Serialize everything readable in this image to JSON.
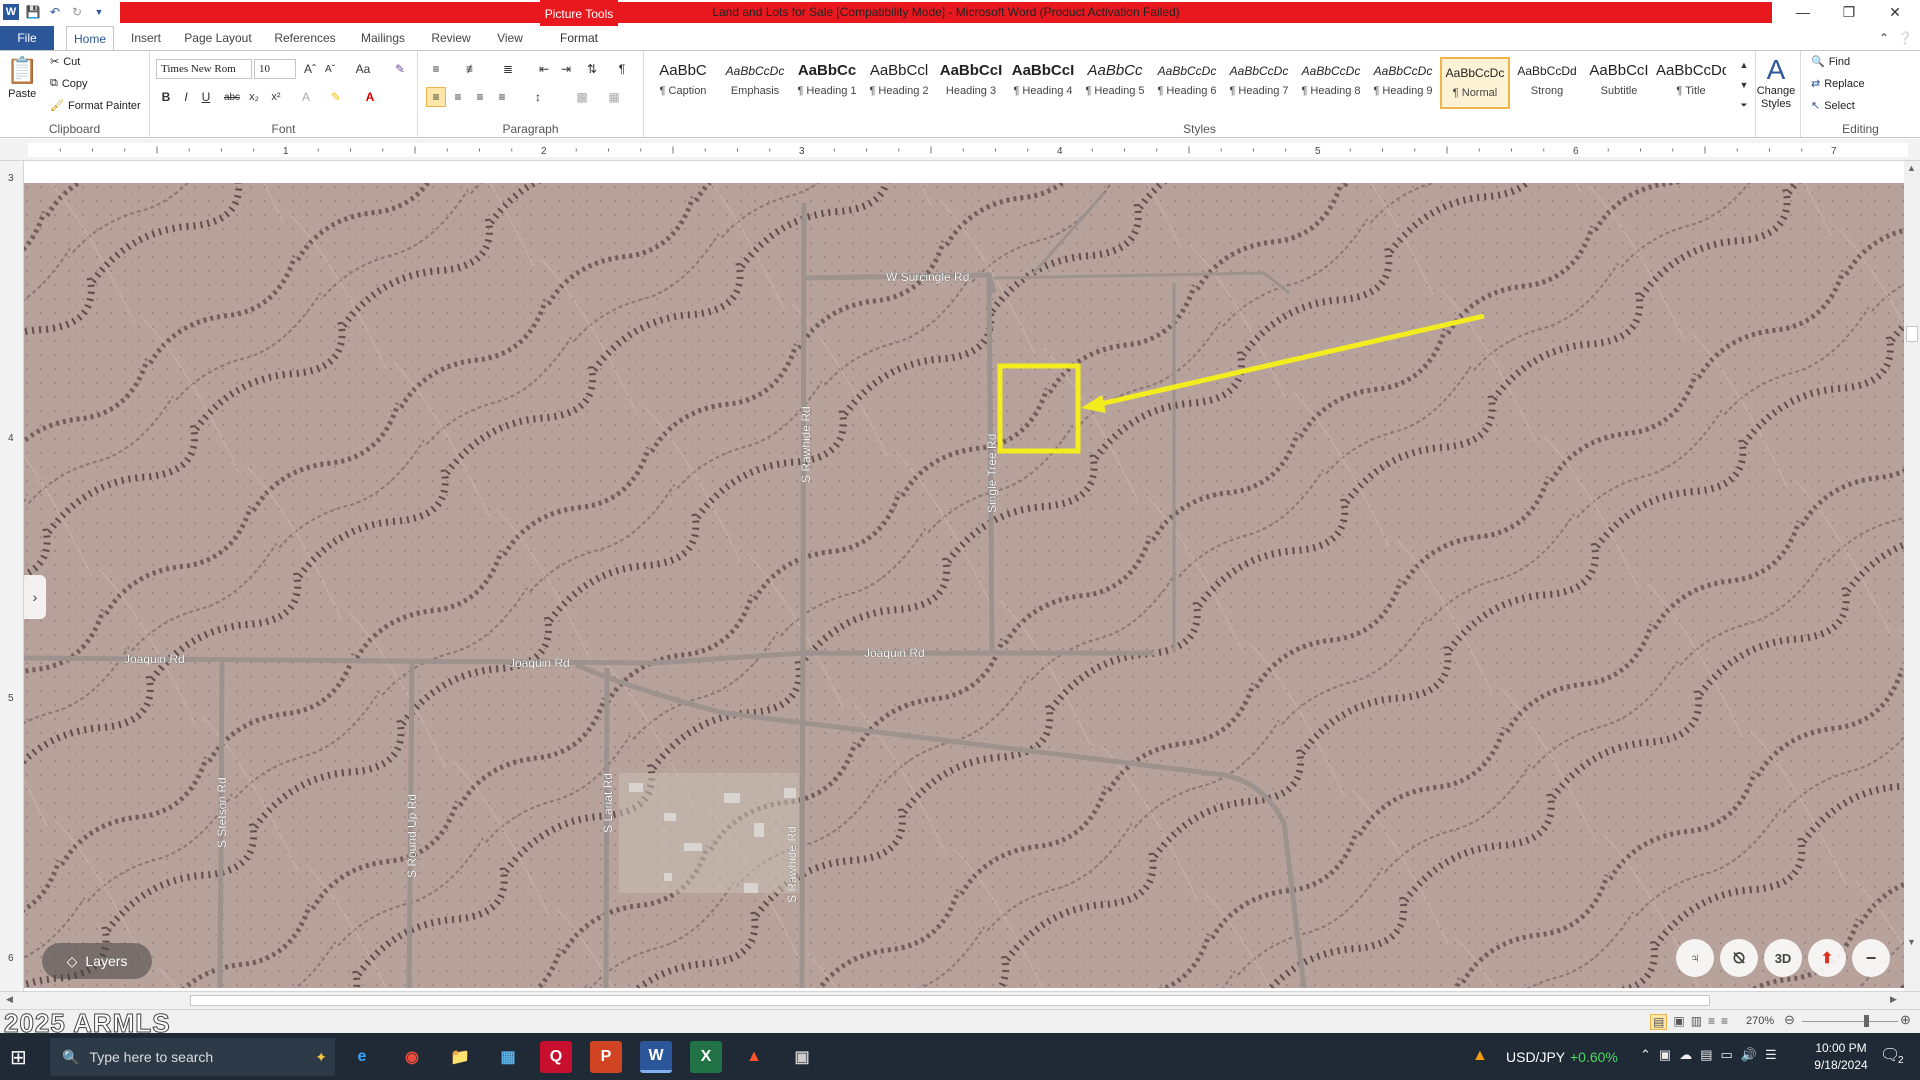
{
  "window": {
    "title": "Land and Lots for Sale [Compatibility Mode] - Microsoft Word (Product Activation Failed)",
    "contextual_tab_group": "Picture Tools",
    "accent": "#2b579a",
    "title_bar_color": "#e8181e"
  },
  "tabs": [
    "File",
    "Home",
    "Insert",
    "Page Layout",
    "References",
    "Mailings",
    "Review",
    "View",
    "Format"
  ],
  "clipboard": {
    "paste": "Paste",
    "cut": "Cut",
    "copy": "Copy",
    "format_painter": "Format Painter",
    "label": "Clipboard"
  },
  "font": {
    "name": "Times New Rom",
    "size": "10",
    "label": "Font",
    "change_case": "Aa"
  },
  "paragraph": {
    "label": "Paragraph"
  },
  "styles": {
    "label": "Styles",
    "items": [
      {
        "preview": "AaBbC",
        "name": "¶ Caption"
      },
      {
        "preview": "AaBbCcDc",
        "name": "Emphasis"
      },
      {
        "preview": "AaBbCc",
        "name": "¶ Heading 1"
      },
      {
        "preview": "AaBbCcl",
        "name": "¶ Heading 2"
      },
      {
        "preview": "AaBbCcI",
        "name": "Heading 3"
      },
      {
        "preview": "AaBbCcI",
        "name": "¶ Heading 4"
      },
      {
        "preview": "AaBbCc",
        "name": "¶ Heading 5"
      },
      {
        "preview": "AaBbCcDc",
        "name": "¶ Heading 6"
      },
      {
        "preview": "AaBbCcDc",
        "name": "¶ Heading 7"
      },
      {
        "preview": "AaBbCcDc",
        "name": "¶ Heading 8"
      },
      {
        "preview": "AaBbCcDc",
        "name": "¶ Heading 9"
      },
      {
        "preview": "AaBbCcDc",
        "name": "¶ Normal"
      },
      {
        "preview": "AaBbCcDd",
        "name": "Strong"
      },
      {
        "preview": "AaBbCcI",
        "name": "Subtitle"
      },
      {
        "preview": "AaBbCcDdI",
        "name": "¶ Title"
      }
    ],
    "change_styles": "Change Styles"
  },
  "editing": {
    "find": "Find",
    "replace": "Replace",
    "select": "Select",
    "label": "Editing"
  },
  "ruler": {
    "numbers": [
      "1",
      "2",
      "3",
      "4",
      "5",
      "6",
      "7"
    ],
    "vnumbers": [
      "3",
      "4",
      "5",
      "6"
    ]
  },
  "map": {
    "roads": [
      "W Surcingle Rd",
      "S Rawhide Rd",
      "Single Tree Rd",
      "Joaquin Rd",
      "Joaquin Rd",
      "Joaquin Rd",
      "S Stetson Rd",
      "S Round Up Rd",
      "S Lariat Rd",
      "S Rawhide Rd"
    ],
    "layers_button": "Layers",
    "view_3d": "3D",
    "highlight_color": "#f3ec1e"
  },
  "watermark": "2025 ARMLS",
  "status": {
    "zoom": "270%"
  },
  "taskbar": {
    "search_placeholder": "Type here to search",
    "ticker": "USD/JPY",
    "ticker_change": "+0.60%",
    "time": "10:00 PM",
    "date": "9/18/2024",
    "notification_count": "2"
  }
}
